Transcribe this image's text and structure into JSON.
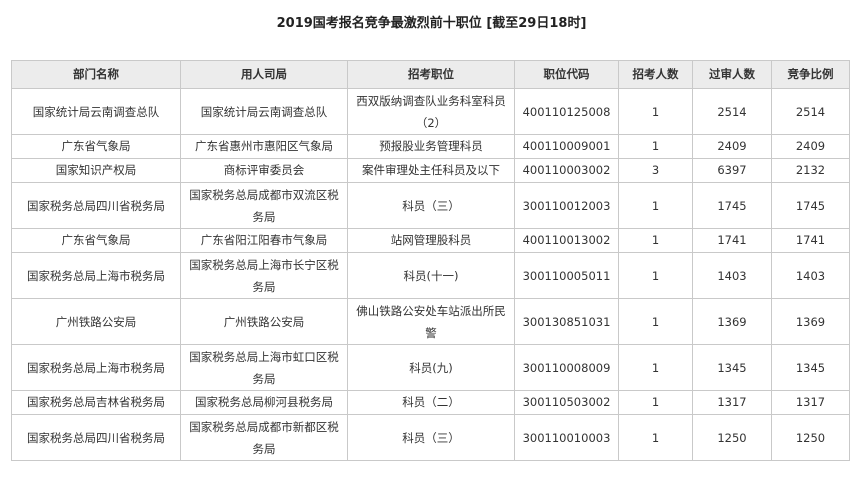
{
  "title": "2019国考报名竞争最激烈前十职位 [截至29日18时]",
  "table": {
    "headers": [
      "部门名称",
      "用人司局",
      "招考职位",
      "职位代码",
      "招考人数",
      "过审人数",
      "竞争比例"
    ],
    "rows": [
      [
        "国家统计局云南调查总队",
        "国家统计局云南调查总队",
        "西双版纳调查队业务科室科员（2）",
        "400110125008",
        "1",
        "2514",
        "2514"
      ],
      [
        "广东省气象局",
        "广东省惠州市惠阳区气象局",
        "预报股业务管理科员",
        "400110009001",
        "1",
        "2409",
        "2409"
      ],
      [
        "国家知识产权局",
        "商标评审委员会",
        "案件审理处主任科员及以下",
        "400110003002",
        "3",
        "6397",
        "2132"
      ],
      [
        "国家税务总局四川省税务局",
        "国家税务总局成都市双流区税务局",
        "科员（三）",
        "300110012003",
        "1",
        "1745",
        "1745"
      ],
      [
        "广东省气象局",
        "广东省阳江阳春市气象局",
        "站网管理股科员",
        "400110013002",
        "1",
        "1741",
        "1741"
      ],
      [
        "国家税务总局上海市税务局",
        "国家税务总局上海市长宁区税务局",
        "科员(十一)",
        "300110005011",
        "1",
        "1403",
        "1403"
      ],
      [
        "广州铁路公安局",
        "广州铁路公安局",
        "佛山铁路公安处车站派出所民警",
        "300130851031",
        "1",
        "1369",
        "1369"
      ],
      [
        "国家税务总局上海市税务局",
        "国家税务总局上海市虹口区税务局",
        "科员(九)",
        "300110008009",
        "1",
        "1345",
        "1345"
      ],
      [
        "国家税务总局吉林省税务局",
        "国家税务总局柳河县税务局",
        "科员（二）",
        "300110503002",
        "1",
        "1317",
        "1317"
      ],
      [
        "国家税务总局四川省税务局",
        "国家税务总局成都市新都区税务局",
        "科员（三）",
        "300110010003",
        "1",
        "1250",
        "1250"
      ]
    ]
  }
}
